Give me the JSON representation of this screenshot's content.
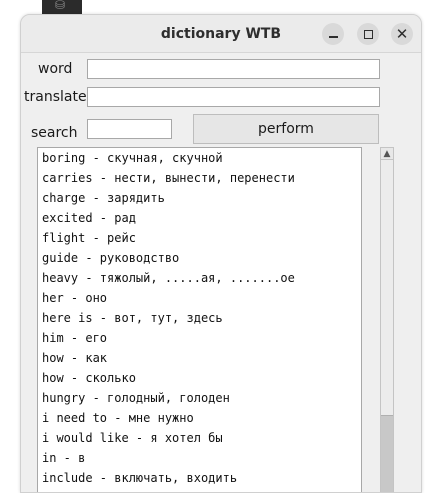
{
  "window": {
    "title": "dictionary WTB",
    "minimize_icon": "minimize-icon",
    "maximize_icon": "maximize-icon",
    "close_icon": "close-icon"
  },
  "form": {
    "word_label": "word",
    "word_value": "",
    "translate_label": "translate",
    "translate_value": "",
    "search_label": "search",
    "search_value": "",
    "perform_label": "perform"
  },
  "list": {
    "items": [
      "boring - скучная, скучной",
      "carries - нести, вынести, перенести",
      "charge - зарядить",
      "excited - рад",
      "flight - рейс",
      "guide - руководство",
      "heavy - тяжолый, .....ая, .......ое",
      "her - оно",
      "here is - вот, тут, здесь",
      "him - его",
      "how - как",
      "how - сколько",
      "hungry - голодный, голоден",
      "i need to - мне нужно",
      "i would like - я хотел бы",
      "in - в",
      "include - включать, входить"
    ]
  }
}
